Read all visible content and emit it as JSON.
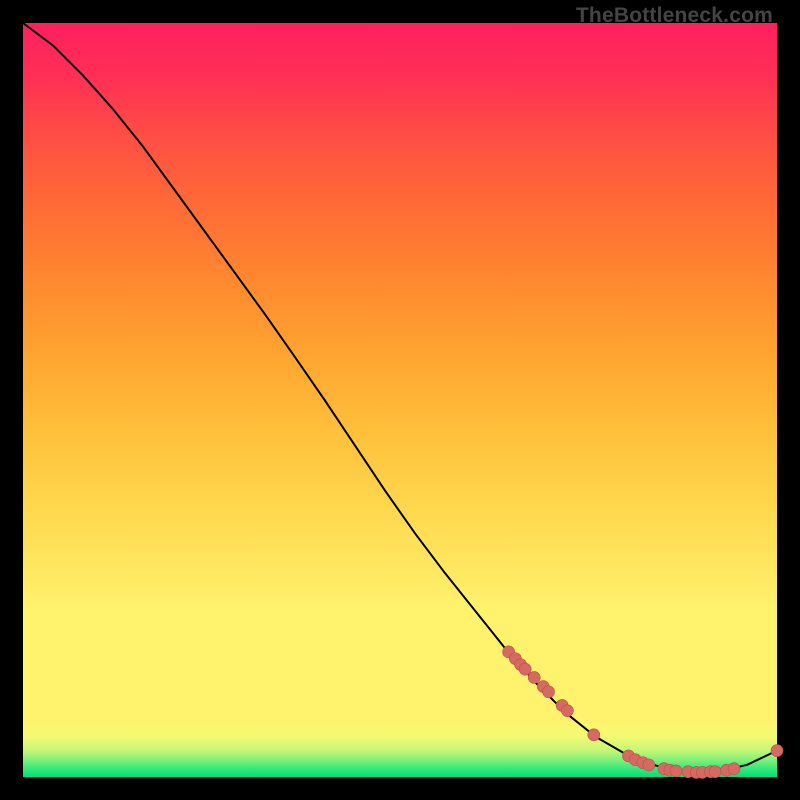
{
  "watermark": "TheBottleneck.com",
  "colors": {
    "background": "#000000",
    "curve": "#000000",
    "dot_fill": "#d46a62",
    "dot_stroke": "#b84f48",
    "gradient_top": "#ff1f5f",
    "gradient_bottom": "#00e07a"
  },
  "chart_data": {
    "type": "line",
    "title": "",
    "xlabel": "",
    "ylabel": "",
    "xlim": [
      0,
      100
    ],
    "ylim": [
      0,
      100
    ],
    "grid": false,
    "legend": null,
    "series": [
      {
        "name": "curve",
        "style": "line",
        "x": [
          0,
          4,
          8,
          12,
          16,
          20,
          24,
          28,
          32,
          36,
          40,
          44,
          48,
          52,
          56,
          60,
          64,
          68,
          72,
          76,
          80,
          84,
          88,
          92,
          96,
          100
        ],
        "y": [
          100,
          97,
          93,
          88.5,
          83.5,
          78,
          72.5,
          67,
          61.5,
          55.8,
          50,
          44,
          38,
          32.3,
          27,
          22,
          17,
          12.5,
          8.5,
          5.3,
          3.0,
          1.5,
          0.7,
          0.7,
          1.6,
          3.5
        ]
      },
      {
        "name": "dots",
        "style": "scatter",
        "x": [
          64.4,
          65.3,
          66.0,
          66.6,
          67.8,
          69.0,
          69.7,
          71.5,
          72.2,
          75.7,
          80.3,
          81.2,
          82.2,
          83.0,
          85.0,
          85.8,
          86.6,
          88.2,
          89.3,
          90.1,
          91.2,
          91.8,
          93.3,
          94.3,
          100.0
        ],
        "y": [
          16.6,
          15.7,
          14.9,
          14.3,
          13.2,
          12.0,
          11.3,
          9.5,
          8.8,
          5.6,
          2.8,
          2.3,
          1.9,
          1.6,
          1.1,
          0.9,
          0.8,
          0.7,
          0.6,
          0.6,
          0.7,
          0.7,
          0.9,
          1.1,
          3.5
        ]
      }
    ],
    "annotations": []
  }
}
